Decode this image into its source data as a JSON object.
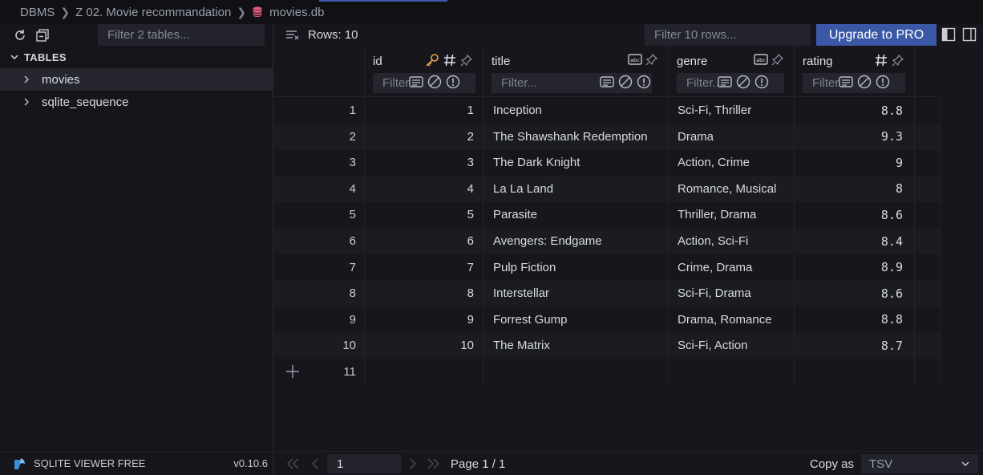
{
  "breadcrumb": {
    "items": [
      "DBMS",
      "Z 02. Movie recommandation",
      "movies.db"
    ]
  },
  "sidebar": {
    "filter_placeholder": "Filter 2 tables...",
    "heading": "TABLES",
    "tables": [
      {
        "label": "movies",
        "active": true
      },
      {
        "label": "sqlite_sequence",
        "active": false
      }
    ],
    "footer_label": "SQLITE VIEWER FREE",
    "version": "v0.10.6"
  },
  "toolbar": {
    "rows_label": "Rows: 10",
    "row_filter_placeholder": "Filter 10 rows...",
    "upgrade_label": "Upgrade to PRO"
  },
  "columns": [
    {
      "name": "id",
      "filter_placeholder": "Filter..."
    },
    {
      "name": "title",
      "filter_placeholder": "Filter..."
    },
    {
      "name": "genre",
      "filter_placeholder": "Filter..."
    },
    {
      "name": "rating",
      "filter_placeholder": "Filter..."
    }
  ],
  "rows": [
    {
      "n": "1",
      "id": "1",
      "title": "Inception",
      "genre": "Sci-Fi, Thriller",
      "rating": "8.8"
    },
    {
      "n": "2",
      "id": "2",
      "title": "The Shawshank Redemption",
      "genre": "Drama",
      "rating": "9.3"
    },
    {
      "n": "3",
      "id": "3",
      "title": "The Dark Knight",
      "genre": "Action, Crime",
      "rating": "9"
    },
    {
      "n": "4",
      "id": "4",
      "title": "La La Land",
      "genre": "Romance, Musical",
      "rating": "8"
    },
    {
      "n": "5",
      "id": "5",
      "title": "Parasite",
      "genre": "Thriller, Drama",
      "rating": "8.6"
    },
    {
      "n": "6",
      "id": "6",
      "title": "Avengers: Endgame",
      "genre": "Action, Sci-Fi",
      "rating": "8.4"
    },
    {
      "n": "7",
      "id": "7",
      "title": "Pulp Fiction",
      "genre": "Crime, Drama",
      "rating": "8.9"
    },
    {
      "n": "8",
      "id": "8",
      "title": "Interstellar",
      "genre": "Sci-Fi, Drama",
      "rating": "8.6"
    },
    {
      "n": "9",
      "id": "9",
      "title": "Forrest Gump",
      "genre": "Drama, Romance",
      "rating": "8.8"
    },
    {
      "n": "10",
      "id": "10",
      "title": "The Matrix",
      "genre": "Sci-Fi, Action",
      "rating": "8.7"
    }
  ],
  "new_row_number": "11",
  "pager": {
    "page_value": "1",
    "page_label": "Page 1 / 1",
    "copy_label": "Copy as",
    "copy_format": "TSV"
  },
  "colors": {
    "accent": "#3a58a6",
    "key_icon": "#e0a84a",
    "db_icon": "#e05a7a"
  }
}
